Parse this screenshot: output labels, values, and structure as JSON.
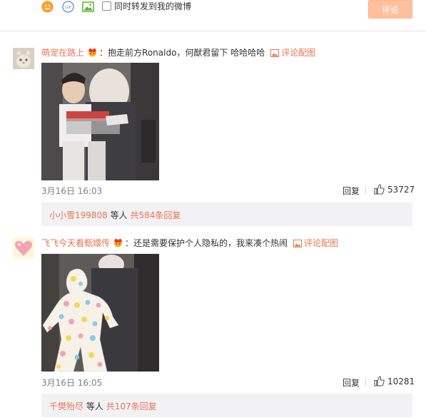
{
  "compose": {
    "emoji_icon": "smiley-icon",
    "gif_icon": "gif-icon",
    "gif_label": "GIF",
    "image_icon": "image-icon",
    "forward_label": "同时转发到我的微博",
    "forward_checked": false,
    "submit_label": "评论"
  },
  "comments": [
    {
      "user": "萌宠在路上",
      "badge": "vip-crown-icon",
      "text": "：抱走前方Ronaldo，何猷君留下 哈哈哈哈",
      "pic_link": "评论配图",
      "time": "3月16日 16:03",
      "reply_label": "回复",
      "likes": "53727",
      "reply_summary": {
        "name": "小小雪199808",
        "middle": "等人",
        "count_text": "共584条回复"
      }
    },
    {
      "user": "飞飞今天看甄嬛传",
      "badge": "vip-crown-icon",
      "text": "：还是需要保护个人隐私的，我来凑个热闹",
      "pic_link": "评论配图",
      "time": "3月16日 16:05",
      "reply_label": "回复",
      "likes": "10281",
      "reply_summary": {
        "name": "千樊殆尽",
        "middle": "等人",
        "count_text": "共107条回复"
      }
    }
  ],
  "colors": {
    "accent": "#eb7350",
    "submit_bg": "#ffc09f",
    "reply_box_bg": "#f2f2f5"
  }
}
